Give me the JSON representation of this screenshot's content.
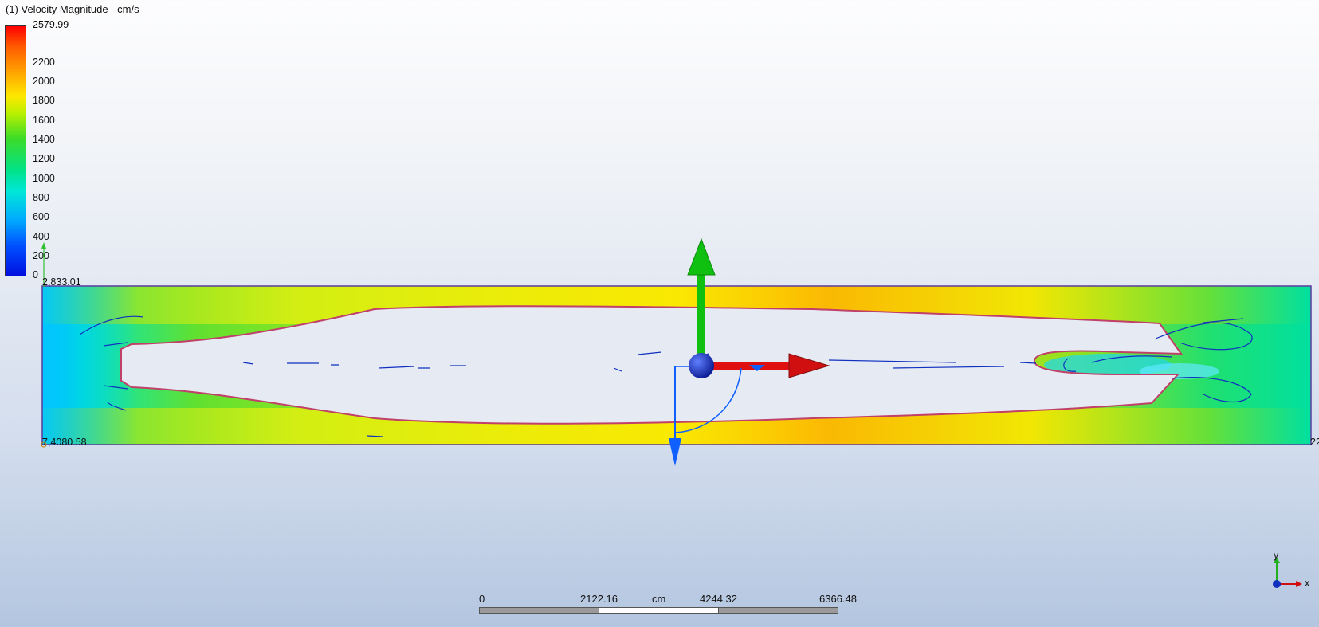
{
  "legend": {
    "title": "(1) Velocity Magnitude - cm/s",
    "max_label": "2579.99",
    "ticks": [
      "2200",
      "2000",
      "1800",
      "1600",
      "1400",
      "1200",
      "1000",
      "800",
      "600",
      "400",
      "200",
      "0"
    ]
  },
  "viewport": {
    "top_left_coord": "2,833.01",
    "bottom_left_coord": "7,4080.58",
    "right_edge_label": "22"
  },
  "scale_bar": {
    "labels": [
      "0",
      "2122.16",
      "cm",
      "4244.32",
      "6366.48"
    ]
  },
  "triad": {
    "y_label": "y",
    "x_label": "x"
  },
  "colors": {
    "field_green": "#3cdc28",
    "field_yellow": "#ffe800",
    "field_orange": "#ffa000",
    "field_cyan": "#00e8c0",
    "field_blue": "#00a8ff",
    "domain_border": "#5a3ca0",
    "body_outline": "#c0406a",
    "arrow_x": "#e01010",
    "arrow_y": "#10c010",
    "arrow_z": "#1060ff",
    "origin_sphere": "#1030c0"
  }
}
